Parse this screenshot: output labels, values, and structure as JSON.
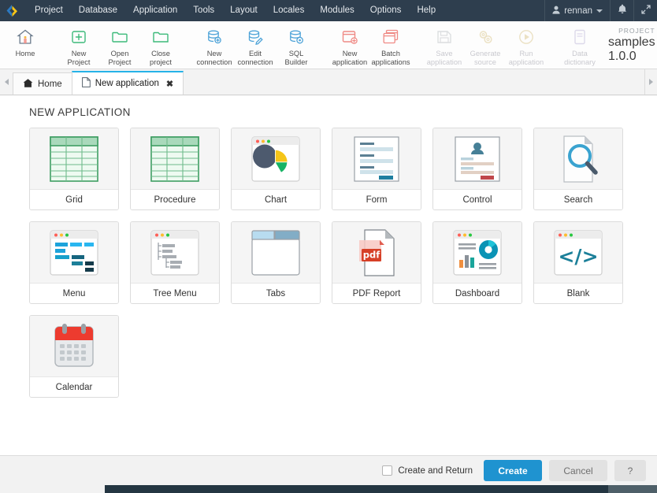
{
  "menubar": {
    "logo_icon": "scriptcase-chevron-logo",
    "items": [
      "Project",
      "Database",
      "Application",
      "Tools",
      "Layout",
      "Locales",
      "Modules",
      "Options",
      "Help"
    ],
    "user": {
      "name": "rennan",
      "icon": "user-icon",
      "caret_icon": "chevron-down-icon"
    },
    "bell_icon": "bell-icon",
    "expand_icon": "expand-arrows-icon"
  },
  "toolbar": {
    "groups": [
      {
        "buttons": [
          {
            "label": "Home",
            "icon": "home-icon",
            "disabled": false
          }
        ]
      },
      {
        "buttons": [
          {
            "label": "New\nProject",
            "icon": "new-project-icon",
            "disabled": false
          },
          {
            "label": "Open\nProject",
            "icon": "open-folder-icon",
            "disabled": false
          },
          {
            "label": "Close\nproject",
            "icon": "close-folder-icon",
            "disabled": false
          }
        ]
      },
      {
        "buttons": [
          {
            "label": "New\nconnection",
            "icon": "new-database-icon",
            "disabled": false
          },
          {
            "label": "Edit\nconnection",
            "icon": "edit-database-icon",
            "disabled": false
          },
          {
            "label": "SQL\nBuilder",
            "icon": "sql-builder-icon",
            "disabled": false
          }
        ]
      },
      {
        "buttons": [
          {
            "label": "New\napplication",
            "icon": "new-application-icon",
            "disabled": false
          },
          {
            "label": "Batch\napplications",
            "icon": "batch-applications-icon",
            "disabled": false
          }
        ]
      },
      {
        "buttons": [
          {
            "label": "Save\napplication",
            "icon": "save-icon",
            "disabled": true
          },
          {
            "label": "Generate\nsource",
            "icon": "gears-icon",
            "disabled": true
          },
          {
            "label": "Run\napplication",
            "icon": "play-icon",
            "disabled": true
          }
        ]
      },
      {
        "buttons": [
          {
            "label": "Data\ndictionary",
            "icon": "data-dictionary-icon",
            "disabled": true
          }
        ]
      }
    ],
    "project_kicker": "PROJECT",
    "project_name": "samples 1.0.0"
  },
  "tabs": {
    "scroll_left_icon": "chevron-left-icon",
    "scroll_right_icon": "chevron-right-icon",
    "items": [
      {
        "label": "Home",
        "icon": "home-icon",
        "active": false,
        "closable": false
      },
      {
        "label": "New application",
        "icon": "document-icon",
        "active": true,
        "closable": true,
        "close_icon": "close-icon"
      }
    ]
  },
  "main": {
    "title": "NEW APPLICATION",
    "cards": [
      {
        "label": "Grid",
        "icon": "grid-table-icon"
      },
      {
        "label": "Procedure",
        "icon": "procedure-table-icon"
      },
      {
        "label": "Chart",
        "icon": "pie-chart-icon"
      },
      {
        "label": "Form",
        "icon": "form-icon"
      },
      {
        "label": "Control",
        "icon": "control-user-form-icon"
      },
      {
        "label": "Search",
        "icon": "search-document-icon"
      },
      {
        "label": "Menu",
        "icon": "menu-blocks-icon"
      },
      {
        "label": "Tree Menu",
        "icon": "tree-menu-icon"
      },
      {
        "label": "Tabs",
        "icon": "tabs-icon"
      },
      {
        "label": "PDF Report",
        "icon": "pdf-report-icon"
      },
      {
        "label": "Dashboard",
        "icon": "dashboard-icon"
      },
      {
        "label": "Blank",
        "icon": "code-blank-icon"
      },
      {
        "label": "Calendar",
        "icon": "calendar-icon"
      }
    ]
  },
  "footer": {
    "create_and_return_label": "Create and Return",
    "create_and_return_checked": false,
    "create_label": "Create",
    "cancel_label": "Cancel",
    "help_label": "?"
  },
  "colors": {
    "menubar_bg": "#2e3e4e",
    "accent_blue": "#1f93d0",
    "tab_active_top": "#26b3e8",
    "logo_blue": "#2b79c2",
    "logo_yellow": "#f5c518"
  }
}
